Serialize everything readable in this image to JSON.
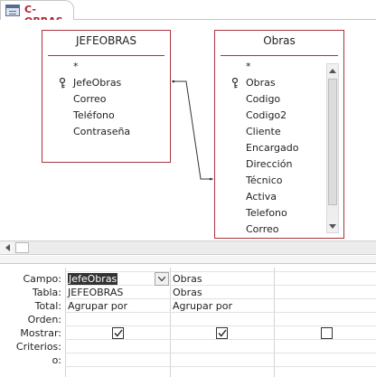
{
  "tab": {
    "title": "C-OBRAS",
    "icon": "query-icon"
  },
  "tables": [
    {
      "name": "JEFEOBRAS",
      "fields": [
        "*",
        "JefeObras",
        "Correo",
        "Teléfono",
        "Contraseña"
      ],
      "key_field": "JefeObras"
    },
    {
      "name": "Obras",
      "fields": [
        "*",
        "Obras",
        "Codigo",
        "Codigo2",
        "Cliente",
        "Encargado",
        "Dirección",
        "Técnico",
        "Activa",
        "Telefono",
        "Correo"
      ],
      "key_field": "Obras"
    }
  ],
  "grid": {
    "row_labels": [
      "Campo:",
      "Tabla:",
      "Total:",
      "Orden:",
      "Mostrar:",
      "Criterios:",
      "o:"
    ],
    "columns": [
      {
        "campo": "JefeObras",
        "tabla": "JEFEOBRAS",
        "total": "Agrupar por",
        "orden": "",
        "mostrar": true,
        "selected": true
      },
      {
        "campo": "Obras",
        "tabla": "Obras",
        "total": "Agrupar por",
        "orden": "",
        "mostrar": true,
        "selected": false
      },
      {
        "campo": "",
        "tabla": "",
        "total": "",
        "orden": "",
        "mostrar": false,
        "selected": false
      }
    ]
  },
  "colors": {
    "table_border": "#a8323e",
    "tab_text": "#b0202c"
  }
}
